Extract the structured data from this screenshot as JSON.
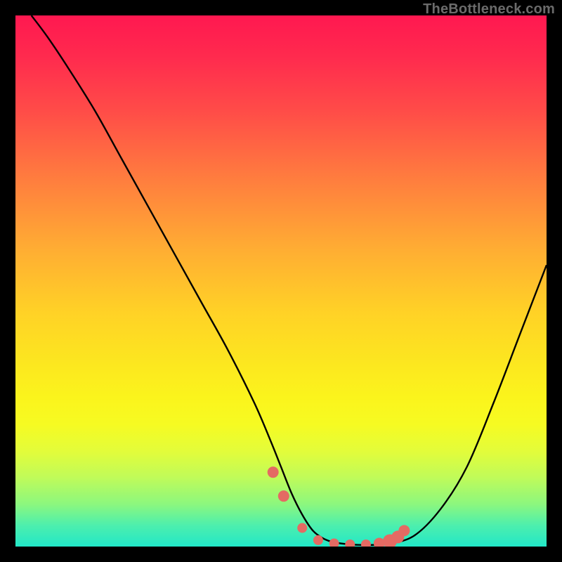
{
  "watermark": "TheBottleneck.com",
  "chart_data": {
    "type": "line",
    "title": "",
    "xlabel": "",
    "ylabel": "",
    "xlim": [
      0,
      100
    ],
    "ylim": [
      0,
      100
    ],
    "series": [
      {
        "name": "curve",
        "x": [
          3,
          6,
          10,
          15,
          20,
          25,
          30,
          35,
          40,
          45,
          48,
          50,
          52,
          54,
          56,
          58,
          60,
          63,
          66,
          70,
          75,
          80,
          85,
          90,
          95,
          100
        ],
        "y": [
          100,
          96,
          90,
          82,
          73,
          64,
          55,
          46,
          37,
          27,
          20,
          15,
          10,
          6,
          3,
          1.5,
          0.8,
          0.4,
          0.3,
          0.5,
          2,
          7,
          15,
          27,
          40,
          53
        ]
      }
    ],
    "markers": {
      "name": "highlight-points",
      "color": "#e46a63",
      "x": [
        48.5,
        50.5,
        54,
        57,
        60,
        63,
        66,
        68.5,
        70.5,
        72,
        73.2
      ],
      "y": [
        14,
        9.5,
        3.5,
        1.2,
        0.6,
        0.4,
        0.4,
        0.6,
        1.0,
        1.8,
        3.0
      ],
      "r": [
        8,
        8,
        7,
        7,
        7,
        7,
        7,
        8,
        10,
        9,
        8
      ]
    }
  }
}
